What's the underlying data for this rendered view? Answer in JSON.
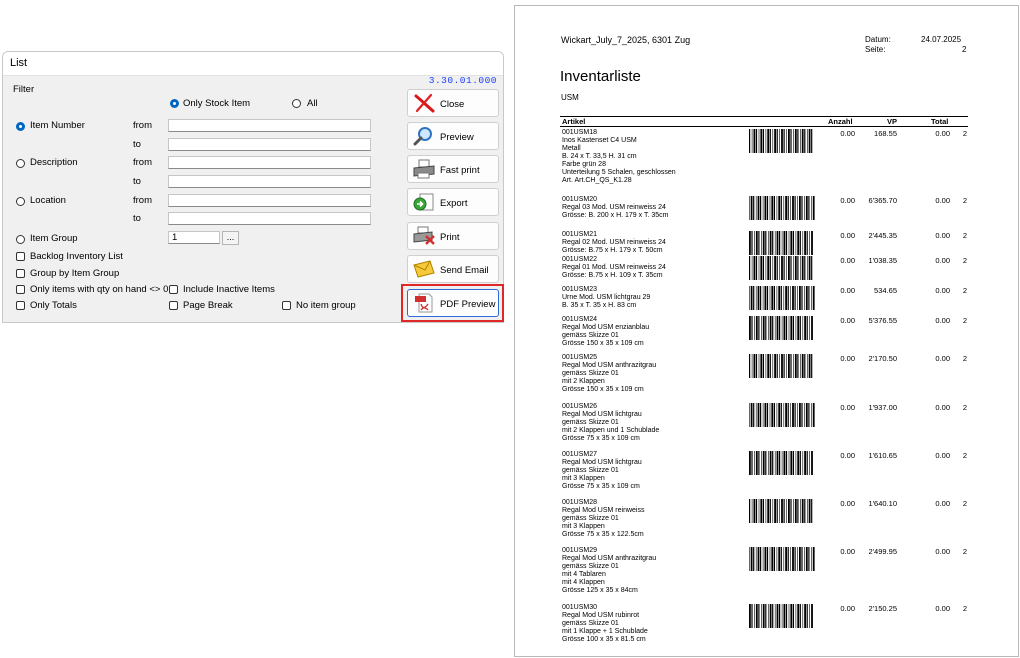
{
  "dialog": {
    "title": "List",
    "version": "3.30.01.000",
    "filter_label": "Filter",
    "stock_radio": {
      "only_stock": "Only Stock Item",
      "all": "All"
    },
    "fields": {
      "item_number": "Item Number",
      "description": "Description",
      "location": "Location",
      "item_group": "Item Group",
      "from": "from",
      "to": "to",
      "item_group_value": "1",
      "ellipsis": "..."
    },
    "checkboxes": {
      "backlog": "Backlog Inventory List",
      "group_by": "Group by Item Group",
      "only_qty": "Only items with qty on hand <> 0",
      "include_inactive": "Include Inactive Items",
      "only_totals": "Only Totals",
      "page_break": "Page Break",
      "no_item_group": "No item group"
    },
    "buttons": {
      "close": "Close",
      "preview": "Preview",
      "fast_print": "Fast print",
      "export": "Export",
      "print": "Print",
      "send_email": "Send Email",
      "pdf_preview": "PDF Preview"
    },
    "icons": [
      "close-icon",
      "magnifier-icon",
      "printer-icon",
      "export-icon",
      "print-icon",
      "envelope-icon",
      "pdf-icon"
    ]
  },
  "document": {
    "header_left": "Wickart_July_7_2025, 6301 Zug",
    "datum_label": "Datum:",
    "datum_value": "24.07.2025",
    "seite_label": "Seite:",
    "seite_value": "2",
    "title": "Inventarliste",
    "subtitle": "USM",
    "columns": {
      "artikel": "Artikel",
      "anzahl": "Anzahl",
      "vp": "VP",
      "total": "Total"
    },
    "items": [
      {
        "lines": [
          "001USM18",
          "Inos Kastenset C4 USM",
          "Metall",
          "B. 24 x T. 33,5 H. 31 cm",
          "Farbe grün 28",
          "Unterteilung 5 Schalen, geschlossen",
          "Art. Art.CH_QS_K1.28"
        ],
        "anzahl": "0.00",
        "vp": "168.55",
        "total": "0.00",
        "extra": "2"
      },
      {
        "lines": [
          "001USM20",
          "Regal 03 Mod. USM reinweiss 24",
          "Grösse: B. 200 x H. 179 x T. 35cm"
        ],
        "anzahl": "0.00",
        "vp": "6'365.70",
        "total": "0.00",
        "extra": "2"
      },
      {
        "lines": [
          "001USM21",
          "Regal 02 Mod. USM reinweiss 24",
          "Grösse: B.75 x H. 179 x T. 50cm"
        ],
        "anzahl": "0.00",
        "vp": "2'445.35",
        "total": "0.00",
        "extra": "2"
      },
      {
        "lines": [
          "001USM22",
          "Regal 01 Mod. USM reinweiss 24",
          "Grösse: B.75 x H. 109 x T. 35cm"
        ],
        "anzahl": "0.00",
        "vp": "1'038.35",
        "total": "0.00",
        "extra": "2"
      },
      {
        "lines": [
          "001USM23",
          "Urne Mod. USM lichtgrau 29",
          "B. 35 x T. 35 x H. 83 cm"
        ],
        "anzahl": "0.00",
        "vp": "534.65",
        "total": "0.00",
        "extra": "2"
      },
      {
        "lines": [
          "001USM24",
          "Regal Mod USM enzianblau",
          "gemäss Skizze 01",
          "Grösse 150 x 35 x 109 cm"
        ],
        "anzahl": "0.00",
        "vp": "5'376.55",
        "total": "0.00",
        "extra": "2"
      },
      {
        "lines": [
          "001USM25",
          "Regal Mod USM anthrazitgrau",
          "gemäss Skizze 01",
          "mit 2 Klappen",
          "Grösse 150 x 35 x 109 cm"
        ],
        "anzahl": "0.00",
        "vp": "2'170.50",
        "total": "0.00",
        "extra": "2"
      },
      {
        "lines": [
          "001USM26",
          "Regal Mod USM lichtgrau",
          "gemäss Skizze 01",
          "mit 2 Klappen und 1 Schublade",
          "Grösse 75 x 35 x 109 cm"
        ],
        "anzahl": "0.00",
        "vp": "1'937.00",
        "total": "0.00",
        "extra": "2"
      },
      {
        "lines": [
          "001USM27",
          "Regal Mod USM lichtgrau",
          "gemäss Skizze 01",
          "mit 3 Klappen",
          "Grösse 75 x 35 x 109 cm"
        ],
        "anzahl": "0.00",
        "vp": "1'610.65",
        "total": "0.00",
        "extra": "2"
      },
      {
        "lines": [
          "001USM28",
          "Regal Mod USM reinweiss",
          "gemäss Skizze 01",
          "mit 3 Klappen",
          "Grösse 75 x 35 x 122.5cm"
        ],
        "anzahl": "0.00",
        "vp": "1'640.10",
        "total": "0.00",
        "extra": "2"
      },
      {
        "lines": [
          "001USM29",
          "Regal Mod USM anthrazitgrau",
          "gemäss Skizze 01",
          "mit 4 Tablaren",
          "mit 4  Klappen",
          "Grösse 125 x 35 x 84cm"
        ],
        "anzahl": "0.00",
        "vp": "2'499.95",
        "total": "0.00",
        "extra": "2"
      },
      {
        "lines": [
          "001USM30",
          "Regal Mod USM rubinrot",
          "gemäss Skizze 01",
          "mit 1 Klappe + 1 Schublade",
          "Grösse 100 x 35 x 81.5 cm"
        ],
        "anzahl": "0.00",
        "vp": "2'150.25",
        "total": "0.00",
        "extra": "2"
      }
    ]
  },
  "colors": {
    "radio_accent": "#0067c0",
    "version_text": "#1a3cff",
    "highlight_outline": "#e12828",
    "pdf_red": "#d32f2f"
  }
}
